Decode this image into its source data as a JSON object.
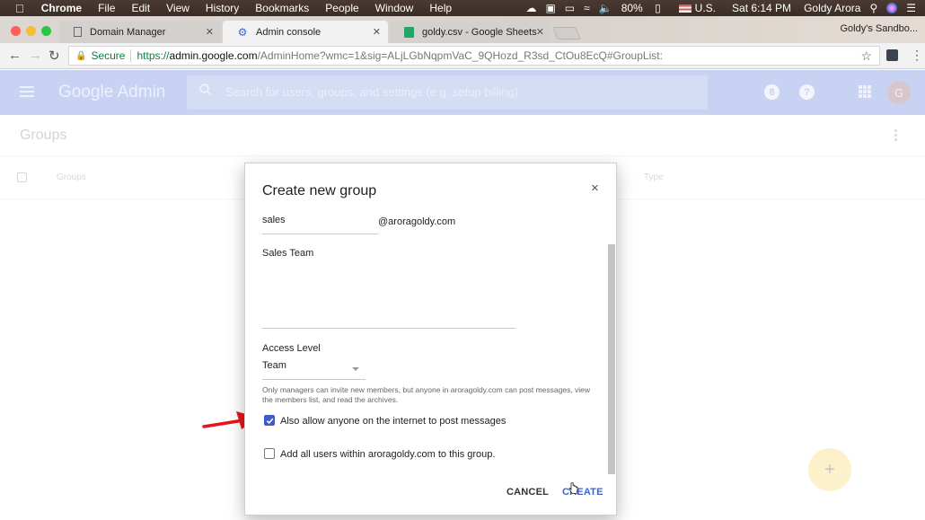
{
  "menubar": {
    "app_name": "Chrome",
    "items": [
      "File",
      "Edit",
      "View",
      "History",
      "Bookmarks",
      "People",
      "Window",
      "Help"
    ],
    "status": {
      "battery": "80%",
      "input_source": "U.S.",
      "clock": "Sat 6:14 PM",
      "user": "Goldy Arora"
    }
  },
  "browser": {
    "tabs": [
      {
        "label": "Domain Manager",
        "icon": "page-icon",
        "active": false
      },
      {
        "label": "Admin console",
        "icon": "admin-gear-icon",
        "active": true
      },
      {
        "label": "goldy.csv - Google Sheets",
        "icon": "sheets-icon",
        "active": false
      }
    ],
    "profile_label": "Goldy's Sandbo...",
    "omnibox": {
      "secure_label": "Secure",
      "scheme": "https://",
      "host": "admin.google.com",
      "path": "/AdminHome?wmc=1&sig=ALjLGbNqpmVaC_9QHozd_R3sd_CtOu8EcQ#GroupList:"
    }
  },
  "appbar": {
    "logo": "Google Admin",
    "search_placeholder": "Search for users, groups, and settings (e.g. setup billing)",
    "notification_badge": "8",
    "help_icon": "?",
    "avatar_initial": "G"
  },
  "page": {
    "title": "Groups",
    "columns": [
      "Groups",
      "Type"
    ],
    "fab_icon": "+"
  },
  "dialog": {
    "title": "Create new group",
    "close_icon": "×",
    "email_value": "sales",
    "email_domain": "@aroragoldy.com",
    "name_value": "Sales Team",
    "access_label": "Access Level",
    "access_value": "Team",
    "access_help": "Only managers can invite new members, but anyone in aroragoldy.com can post messages, view the members list, and read the archives.",
    "checkboxes": [
      {
        "label": "Also allow anyone on the internet to post messages",
        "checked": true
      },
      {
        "label": "Add all users within aroragoldy.com to this group.",
        "checked": false
      }
    ],
    "cancel_label": "CANCEL",
    "create_label": "CREATE"
  },
  "colors": {
    "accent_blue": "#3f5ccc",
    "appbar_dimmed": "#c8d2f2",
    "fab_dimmed": "#fdf1cc",
    "annotation_arrow": "#e8141a"
  }
}
